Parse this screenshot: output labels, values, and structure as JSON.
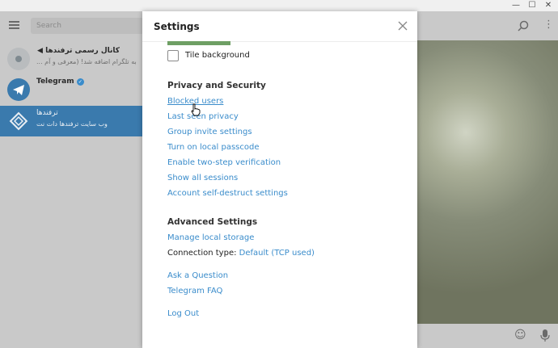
{
  "left_panel": {
    "search_placeholder": "Search",
    "chats": [
      {
        "name": "کانال رسمی ترفندها",
        "message": "... به تلگرام اضافه شد! (معرفی و آم",
        "avatar_color": "#7d8f99"
      },
      {
        "name": "Telegram",
        "message": "",
        "avatar_color": "#3a7aad"
      },
      {
        "name": "ترفندها",
        "message": "وب سایت ترفندها دات نت",
        "avatar_color": "#3a7aad"
      }
    ]
  },
  "dialog": {
    "title": "Settings",
    "tile_background_label": "Tile background",
    "privacy_section": "Privacy and Security",
    "privacy_links": [
      "Blocked users",
      "Last seen privacy",
      "Group invite settings",
      "Turn on local passcode",
      "Enable two-step verification",
      "Show all sessions",
      "Account self-destruct settings"
    ],
    "advanced_section": "Advanced Settings",
    "manage_storage": "Manage local storage",
    "connection_label": "Connection type:",
    "connection_value": "Default (TCP used)",
    "ask_question": "Ask a Question",
    "faq": "Telegram FAQ",
    "logout": "Log Out"
  },
  "colors": {
    "accent": "#3a8ccb",
    "selected_chat": "#3a7aad"
  }
}
